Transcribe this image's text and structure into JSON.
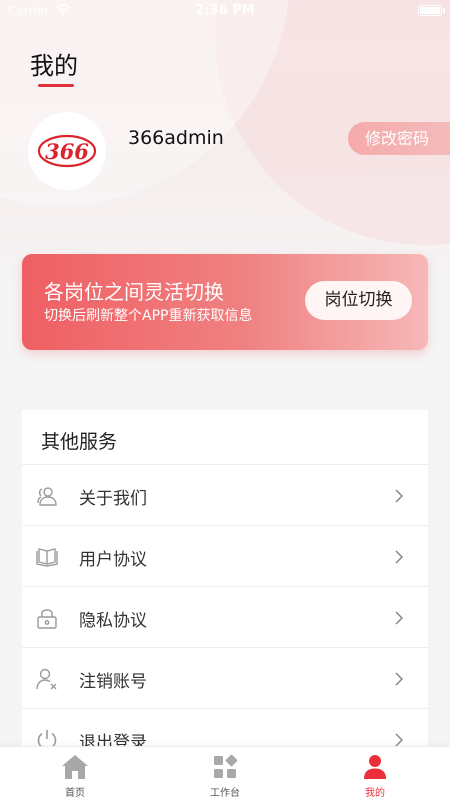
{
  "status_bar": {
    "carrier": "Carrier",
    "time": "2:36 PM"
  },
  "header": {
    "title": "我的"
  },
  "profile": {
    "avatar_text": "366",
    "username": "366admin",
    "change_password_label": "修改密码"
  },
  "role_switch": {
    "title": "各岗位之间灵活切换",
    "subtitle": "切换后刷新整个APP重新获取信息",
    "button_label": "岗位切换"
  },
  "services": {
    "title": "其他服务",
    "items": [
      {
        "label": "关于我们",
        "icon": "users-icon"
      },
      {
        "label": "用户协议",
        "icon": "book-icon"
      },
      {
        "label": "隐私协议",
        "icon": "lock-icon"
      },
      {
        "label": "注销账号",
        "icon": "user-remove-icon"
      },
      {
        "label": "退出登录",
        "icon": "power-icon"
      }
    ]
  },
  "tabbar": {
    "items": [
      {
        "label": "首页",
        "icon": "home-icon",
        "active": false
      },
      {
        "label": "工作台",
        "icon": "workbench-icon",
        "active": false
      },
      {
        "label": "我的",
        "icon": "person-icon",
        "active": true
      }
    ]
  },
  "colors": {
    "accent": "#ea2f3a",
    "card_gradient_start": "#ef5f63",
    "card_gradient_end": "#f7b8b8"
  }
}
